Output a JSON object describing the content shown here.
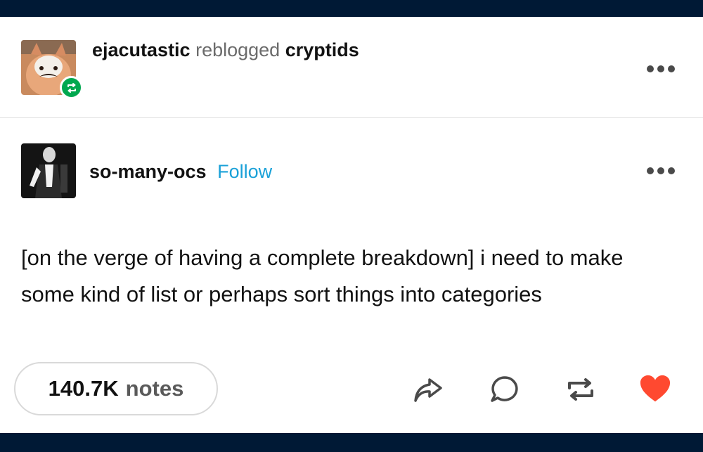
{
  "reblog": {
    "reblogger": "ejacutastic",
    "verb": "reblogged",
    "source": "cryptids"
  },
  "post": {
    "author": "so-many-ocs",
    "follow_label": "Follow",
    "body": "[on the verge of having a complete breakdown] i need to make some kind of list or perhaps sort things into categories"
  },
  "footer": {
    "notes_count": "140.7K",
    "notes_label": "notes",
    "actions": [
      "share-icon",
      "comment-icon",
      "reblog-icon",
      "like-icon"
    ]
  },
  "colors": {
    "background": "#001935",
    "follow": "#1aa1d8",
    "reblog_badge": "#00a84f",
    "like": "#ff4930"
  }
}
